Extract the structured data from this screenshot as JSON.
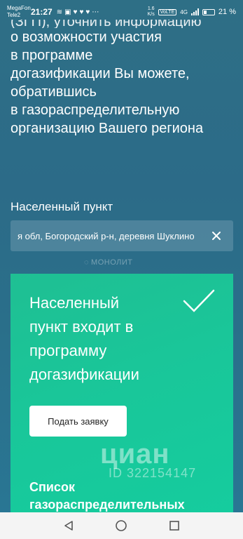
{
  "status_bar": {
    "carrier_1": "MegaFon",
    "carrier_2": "Tele2",
    "time": "21:27",
    "icons": [
      "wifi-icon",
      "notification-icon",
      "heart-icon",
      "heart-icon",
      "heart-icon",
      "more-icon"
    ],
    "net_speed_value": "1.6",
    "net_speed_unit": "K/s",
    "volte": "VoLTE",
    "network": "4G",
    "battery": "21 %"
  },
  "intro": {
    "cut_line": "(ЗГП), уточнить информацию",
    "lines": [
      "о возможности участия",
      "в программе",
      "догазификации Вы можете,",
      "обратившись",
      "в газораспределительную",
      "организацию Вашего региона"
    ]
  },
  "locality": {
    "label": "Населенный пункт",
    "value": "я обл, Богородский р-н, деревня Шуклино"
  },
  "watermark_top": "МОНОЛИТ",
  "result": {
    "title_lines": [
      "Населенный",
      "пункт входит в",
      "программу",
      "догазификации"
    ],
    "button_label": "Подать заявку",
    "list_title_lines": [
      "Список",
      "газораспределительных"
    ]
  },
  "watermark": {
    "brand": "циан",
    "id": "ID 322154147"
  },
  "colors": {
    "background": "#2c6b88",
    "card": "#19c79a",
    "text": "#ffffff"
  }
}
